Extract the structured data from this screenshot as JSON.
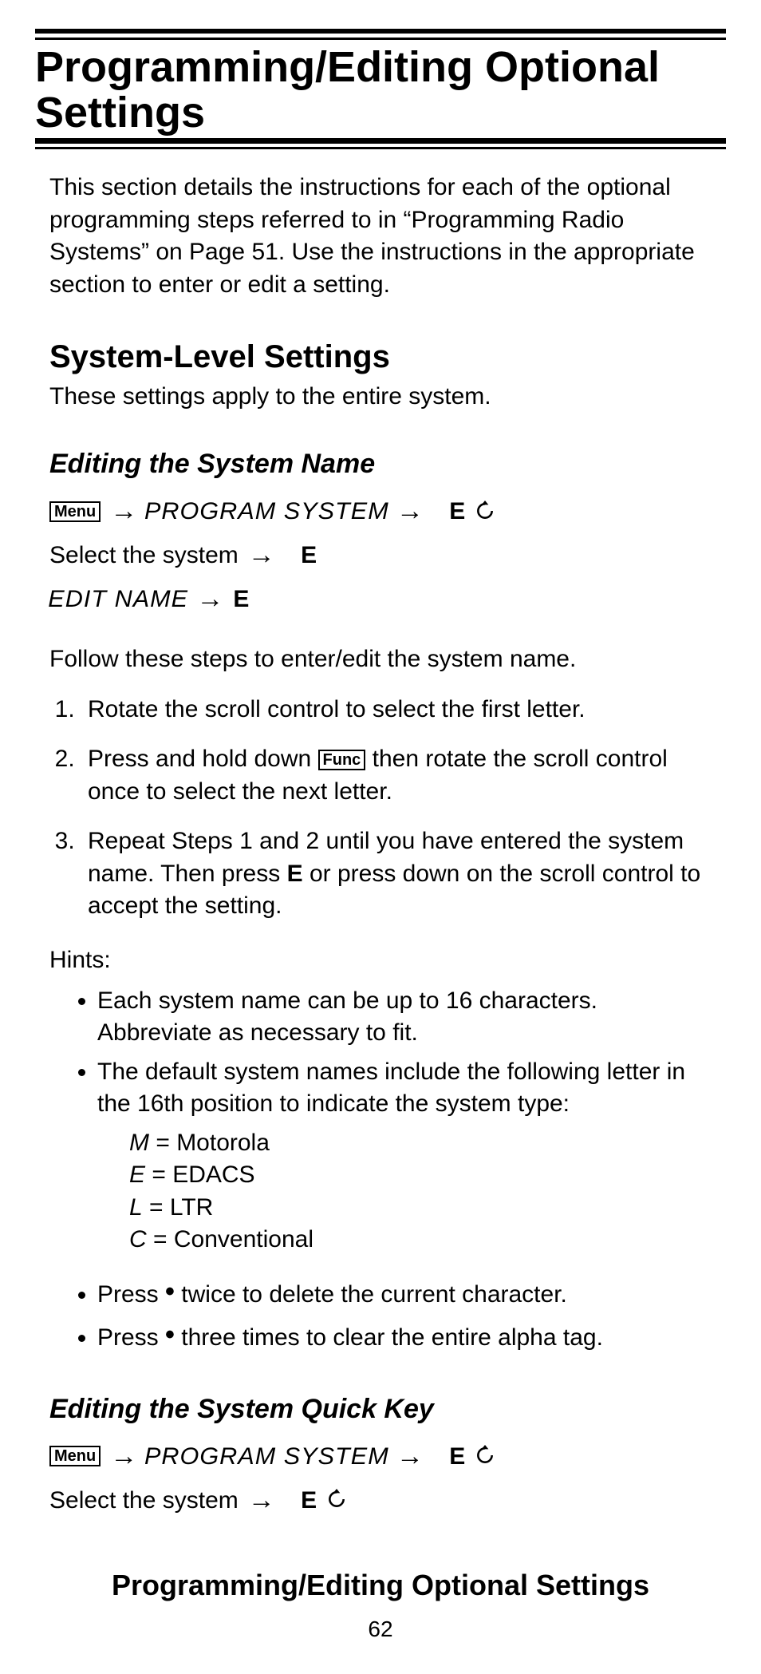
{
  "page_title": "Programming/Editing Optional Settings",
  "intro": "This section details the instructions for each of the optional programming steps referred to in “Programming Radio Systems” on Page 51. Use the instructions in the appropriate section to enter or edit a setting.",
  "section1_heading": "System-Level Settings",
  "section1_sub": "These settings apply to the entire system.",
  "edit_name_heading": "Editing the System Name",
  "keycap_menu": "Menu",
  "keycap_func": "Func",
  "arrow": "→",
  "lcd_program_system": "PROGRAM SYSTEM",
  "e_key": "E",
  "select_system": "Select the system",
  "lcd_edit_name": "EDIT NAME",
  "follow_steps": "Follow these steps to enter/edit the system name.",
  "step1": "Rotate the scroll control to select the first letter.",
  "step2_a": "Press and hold down ",
  "step2_b": " then rotate the scroll control once to select the next letter.",
  "step3_a": "Repeat Steps 1 and 2 until you have entered the system name. Then press ",
  "step3_b": " or press down on the scroll control to accept the setting.",
  "hints_label": "Hints:",
  "hint1": "Each system name can be up to 16 characters. Abbreviate as necessary to fit.",
  "hint2": "The default system names include the following letter in the 16th position to indicate the system type:",
  "code_m_sym": "M",
  "code_m": " = Motorola",
  "code_e_sym": "E",
  "code_e": " = EDACS",
  "code_l_sym": "L",
  "code_l": " = LTR",
  "code_c_sym": "C",
  "code_c": " = Conventional",
  "hint3_a": "Press ",
  "hint3_b": " twice to delete the current character.",
  "hint4_a": "Press ",
  "hint4_b": " three times to clear the entire alpha tag.",
  "dot": "•",
  "edit_quick_key_heading": "Editing the System Quick Key",
  "footer_title": "Programming/Editing Optional Settings",
  "page_number": "62"
}
